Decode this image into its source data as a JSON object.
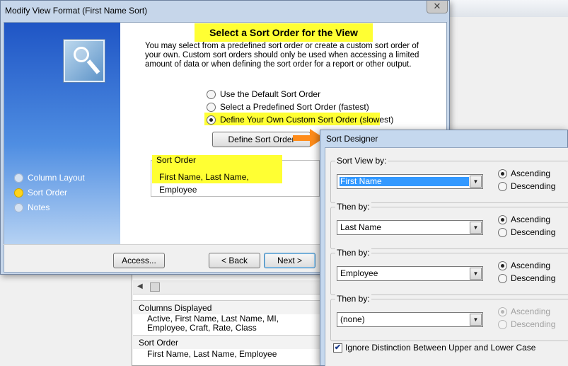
{
  "window": {
    "title": "Modify View Format (First Name Sort)",
    "close_glyph": "✕",
    "heading": "Select a Sort Order for the View",
    "intro": "You may select from a predefined sort order or create a custom sort order of your own. Custom sort orders should only be used when accessing a limited amount of data or when defining the sort order for a report or other output.",
    "options": [
      {
        "label": "Use the Default Sort Order",
        "selected": false
      },
      {
        "label": "Select a Predefined Sort Order (fastest)",
        "selected": false
      },
      {
        "label": "Define Your Own Custom Sort Order (slowest)",
        "selected": true
      }
    ],
    "define_button": "Define Sort Order",
    "sort_order_label": "Sort Order",
    "sort_order_value": "First Name,  Last Name, Employee",
    "nav": [
      {
        "label": "Column Layout",
        "active": false
      },
      {
        "label": "Sort Order",
        "active": true
      },
      {
        "label": "Notes",
        "active": false
      }
    ],
    "buttons": {
      "access": "Access...",
      "back": "< Back",
      "next": "Next >"
    }
  },
  "background": {
    "scroll_arrow": "◀",
    "columns_label": "Columns Displayed",
    "columns_value": "Active, First Name, Last Name, MI, Employee, Craft, Rate, Class",
    "sort_label": "Sort Order",
    "sort_value": "First Name,  Last Name, Employee"
  },
  "sort_designer": {
    "title": "Sort Designer",
    "dropdown_glyph": "▼",
    "groups": [
      {
        "label": "Sort View by:",
        "field": "First Name",
        "direction": "Ascending",
        "enabled": true
      },
      {
        "label": "Then by:",
        "field": "Last Name",
        "direction": "Ascending",
        "enabled": true
      },
      {
        "label": "Then by:",
        "field": "Employee",
        "direction": "Ascending",
        "enabled": true
      },
      {
        "label": "Then by:",
        "field": "(none)",
        "direction": "Ascending",
        "enabled": false
      }
    ],
    "ascending_label": "Ascending",
    "descending_label": "Descending",
    "ignore_case_label": "Ignore Distinction Between Upper and Lower Case",
    "ignore_case_checked": true,
    "check_glyph": "✔"
  },
  "colors": {
    "highlight": "#ffff33",
    "accent_arrow": "#ff8c1a",
    "selection": "#3399ff"
  }
}
